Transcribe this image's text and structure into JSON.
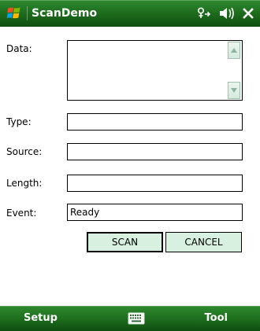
{
  "titlebar": {
    "app_title": "ScanDemo",
    "icons": [
      "windows-flag-icon",
      "connectivity-icon",
      "volume-icon",
      "close-icon"
    ],
    "status_glyphs": {
      "connectivity": "⚲",
      "volume": "◀",
      "close": "✕"
    }
  },
  "form": {
    "data_label": "Data:",
    "type_label": "Type:",
    "source_label": "Source:",
    "length_label": "Length:",
    "event_label": "Event:",
    "data_value": "",
    "type_value": "",
    "source_value": "",
    "length_value": "",
    "event_value": "Ready"
  },
  "buttons": {
    "scan": "SCAN",
    "cancel": "CANCEL"
  },
  "bottombar": {
    "left_softkey": "Setup",
    "right_softkey": "Tool",
    "keyboard_icon": "keyboard-icon"
  },
  "colors": {
    "bar_green": "#1f6f1f",
    "button_fill": "#d7f0df",
    "text_white": "#ffffff"
  }
}
